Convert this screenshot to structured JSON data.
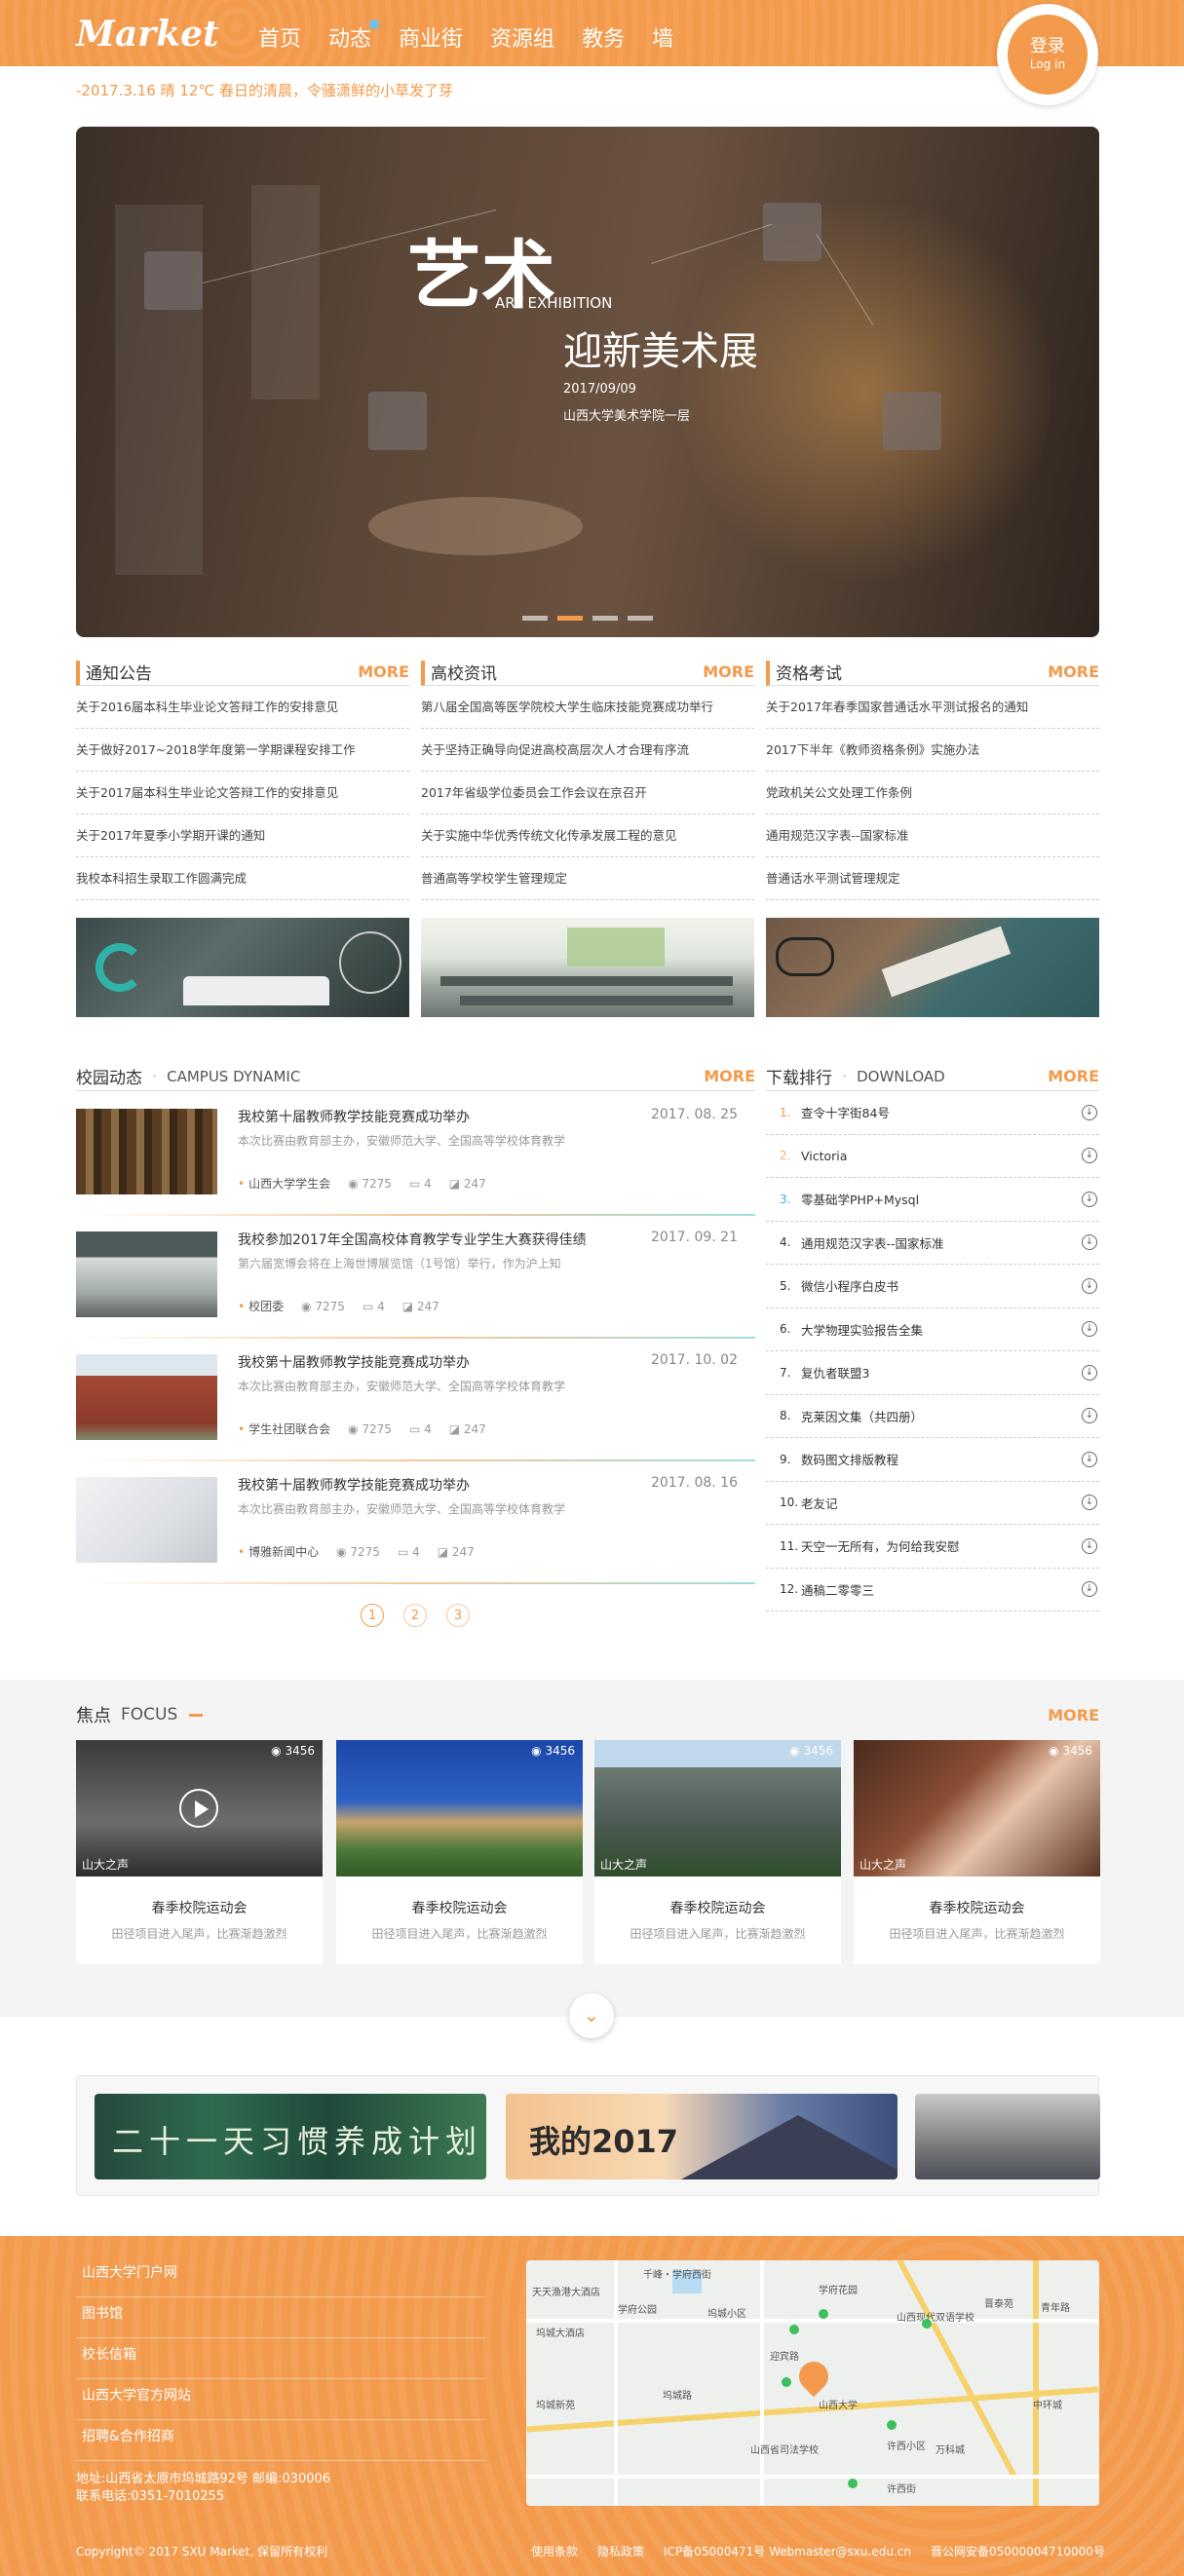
{
  "header": {
    "logo": "Market",
    "nav": [
      "首页",
      "动态",
      "商业街",
      "资源组",
      "教务",
      "墙"
    ],
    "login_cn": "登录",
    "login_en": "Log in"
  },
  "ticker": "-2017.3.16  晴  12℃  春日的清晨，令骚潇鲜的小草发了芽",
  "banner": {
    "big": "艺术",
    "en": "ART EXHIBITION",
    "title": "迎新美术展",
    "date": "2017/09/09",
    "location": "山西大学美术学院一层"
  },
  "more_label": "MORE",
  "news": [
    {
      "title": "通知公告",
      "items": [
        "关于2016届本科生毕业论文答辩工作的安排意见",
        "关于做好2017~2018学年度第一学期课程安排工作",
        "关于2017届本科生毕业论文答辩工作的安排意见",
        "关于2017年夏季小学期开课的通知",
        "我校本科招生录取工作圆满完成"
      ]
    },
    {
      "title": "高校资讯",
      "items": [
        "第八届全国高等医学院校大学生临床技能竞赛成功举行",
        "关于坚持正确导向促进高校高层次人才合理有序流",
        "2017年省级学位委员会工作会议在京召开",
        "关于实施中华优秀传统文化传承发展工程的意见",
        "普通高等学校学生管理规定"
      ]
    },
    {
      "title": "资格考试",
      "items": [
        "关于2017年春季国家普通话水平测试报名的通知",
        "2017下半年《教师资格条例》实施办法",
        "党政机关公文处理工作条例",
        "通用规范汉字表--国家标准",
        "普通话水平测试管理规定"
      ]
    }
  ],
  "campus": {
    "title": "校园动态",
    "en": "CAMPUS DYNAMIC",
    "items": [
      {
        "title": "我校第十届教师教学技能竞赛成功举办",
        "date": "2017. 08. 25",
        "desc": "本次比赛由教育部主办，安徽师范大学、全国高等学校体育教学",
        "source": "山西大学学生会",
        "views": "7275",
        "comments": "4",
        "likes": "247"
      },
      {
        "title": "我校参加2017年全国高校体育教学专业学生大赛获得佳绩",
        "date": "2017. 09. 21",
        "desc": "第六届宽博会将在上海世博展览馆（1号馆）举行，作为沪上知",
        "source": "校团委",
        "views": "7275",
        "comments": "4",
        "likes": "247"
      },
      {
        "title": "我校第十届教师教学技能竞赛成功举办",
        "date": "2017. 10. 02",
        "desc": "本次比赛由教育部主办，安徽师范大学、全国高等学校体育教学",
        "source": "学生社团联合会",
        "views": "7275",
        "comments": "4",
        "likes": "247"
      },
      {
        "title": "我校第十届教师教学技能竞赛成功举办",
        "date": "2017. 08. 16",
        "desc": "本次比赛由教育部主办，安徽师范大学、全国高等学校体育教学",
        "source": "博雅新闻中心",
        "views": "7275",
        "comments": "4",
        "likes": "247"
      }
    ],
    "pages": [
      "1",
      "2",
      "3"
    ]
  },
  "download": {
    "title": "下载排行",
    "en": "DOWNLOAD",
    "items": [
      {
        "n": "1.",
        "name": "查令十字街84号"
      },
      {
        "n": "2.",
        "name": "Victoria"
      },
      {
        "n": "3.",
        "name": "零基础学PHP+Mysql"
      },
      {
        "n": "4.",
        "name": "通用规范汉字表--国家标准"
      },
      {
        "n": "5.",
        "name": "微信小程序白皮书"
      },
      {
        "n": "6.",
        "name": "大学物理实验报告全集"
      },
      {
        "n": "7.",
        "name": "复仇者联盟3"
      },
      {
        "n": "8.",
        "name": "克莱因文集（共四册）"
      },
      {
        "n": "9.",
        "name": "数码图文排版教程"
      },
      {
        "n": "10.",
        "name": "老友记"
      },
      {
        "n": "11.",
        "name": "天空一无所有，为何给我安慰"
      },
      {
        "n": "12.",
        "name": "通稿二零零三"
      }
    ]
  },
  "focus": {
    "title": "焦点",
    "en": "FOCUS",
    "cards": [
      {
        "views": "3456",
        "wm": "山大之声",
        "title": "春季校院运动会",
        "desc": "田径项目进入尾声，比赛渐趋激烈"
      },
      {
        "views": "3456",
        "wm": "",
        "title": "春季校院运动会",
        "desc": "田径项目进入尾声，比赛渐趋激烈"
      },
      {
        "views": "3456",
        "wm": "山大之声",
        "title": "春季校院运动会",
        "desc": "田径项目进入尾声，比赛渐趋激烈"
      },
      {
        "views": "3456",
        "wm": "山大之声",
        "title": "春季校院运动会",
        "desc": "田径项目进入尾声，比赛渐趋激烈"
      }
    ]
  },
  "ads": {
    "ad1": "二十一天习惯养成计划",
    "ad2": "我的2017"
  },
  "footer": {
    "links": [
      "山西大学门户网",
      "图书馆",
      "校长信箱",
      "山西大学官方网站",
      "招聘&合作招商"
    ],
    "address": "地址:山西省太原市坞城路92号  邮编:030006",
    "phone": "联系电话:0351-7010255",
    "copyright": "Copyright© 2017 SXU Market, 保留所有权利",
    "right": [
      "使用条款",
      "隐私政策",
      "ICP备05000471号  Webmaster@sxu.edu.cn",
      "晋公网安备05000004710000号"
    ],
    "map_labels": [
      "千峰・学府西街",
      "天天渔港大酒店",
      "学府公园",
      "坞城大酒店",
      "坞城小区",
      "学府花园",
      "山西现代双语学校",
      "晋泰苑",
      "青年路",
      "迎宾路",
      "坞城路",
      "坞城新苑",
      "山西大学",
      "山西省司法学校",
      "许西小区",
      "万科城",
      "许西街",
      "中环城"
    ]
  },
  "colors": {
    "accent": "#f39a4c",
    "teal": "#39b7d9"
  }
}
